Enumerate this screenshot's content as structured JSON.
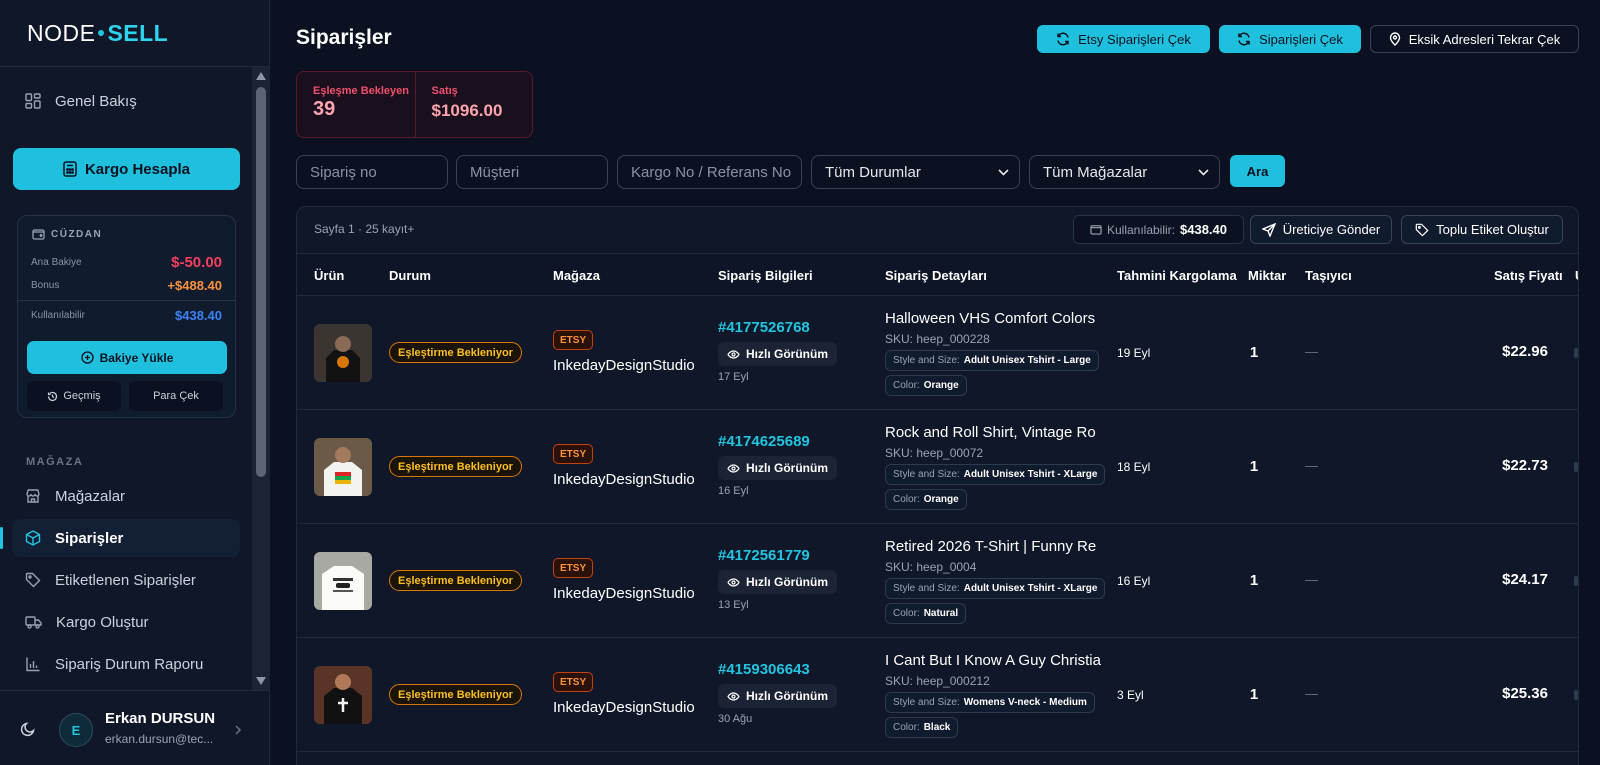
{
  "logo": {
    "part1": "NODE",
    "part2": "SELL"
  },
  "sidebar": {
    "overview": "Genel Bakış",
    "cargo_button": "Kargo Hesapla",
    "wallet": {
      "title": "CÜZDAN",
      "main_balance_label": "Ana Bakiye",
      "main_balance_value": "$-50.00",
      "bonus_label": "Bonus",
      "bonus_value": "+$488.40",
      "available_label": "Kullanılabilir",
      "available_value": "$438.40",
      "topup_button": "Bakiye Yükle",
      "history_button": "Geçmiş",
      "withdraw_button": "Para Çek"
    },
    "section_store": "MAĞAZA",
    "items": [
      {
        "label": "Mağazalar"
      },
      {
        "label": "Siparişler"
      },
      {
        "label": "Etiketlenen Siparişler"
      },
      {
        "label": "Kargo Oluştur"
      },
      {
        "label": "Sipariş Durum Raporu"
      }
    ]
  },
  "user": {
    "initial": "E",
    "name": "Erkan DURSUN",
    "email": "erkan.dursun@tec..."
  },
  "header": {
    "title": "Siparişler",
    "btn_etsy": "Etsy Siparişleri Çek",
    "btn_orders": "Siparişleri Çek",
    "btn_address": "Eksik Adresleri Tekrar Çek"
  },
  "stats": {
    "pending_label": "Eşleşme Bekleyen",
    "pending_value": "39",
    "sales_label": "Satış",
    "sales_value": "$1096.00"
  },
  "filters": {
    "order_no_placeholder": "Sipariş no",
    "customer_placeholder": "Müşteri",
    "cargo_placeholder": "Kargo No / Referans No",
    "status_select": "Tüm Durumlar",
    "store_select": "Tüm Mağazalar",
    "search_button": "Ara"
  },
  "table": {
    "paging": "Sayfa 1 · 25 kayıt+",
    "available_label": "Kullanılabilir:",
    "available_value": "$438.40",
    "send_producer": "Üreticiye Gönder",
    "bulk_label": "Toplu Etiket Oluştur",
    "headers": {
      "product": "Ürün",
      "status": "Durum",
      "store": "Mağaza",
      "order_info": "Sipariş Bilgileri",
      "order_details": "Sipariş Detayları",
      "est_shipping": "Tahmini Kargolama",
      "qty": "Miktar",
      "carrier": "Taşıyıcı",
      "price": "Satış Fiyatı",
      "extra": "U"
    },
    "rows": [
      {
        "status": "Eşleştirme Bekleniyor",
        "channel": "ETSY",
        "shop": "InkedayDesignStudio",
        "order_no": "#4177526768",
        "quick": "Hızlı Görünüm",
        "date": "17 Eyl",
        "title": "Halloween VHS Comfort Colors",
        "sku": "SKU: heep_000228",
        "opt1_label": "Style and Size:",
        "opt1_value": "Adult Unisex Tshirt - Large",
        "opt2_label": "Color:",
        "opt2_value": "Orange",
        "ship": "19 Eyl",
        "qty": "1",
        "carrier": "—",
        "price": "$22.96"
      },
      {
        "status": "Eşleştirme Bekleniyor",
        "channel": "ETSY",
        "shop": "InkedayDesignStudio",
        "order_no": "#4174625689",
        "quick": "Hızlı Görünüm",
        "date": "16 Eyl",
        "title": "Rock and Roll Shirt, Vintage Ro",
        "sku": "SKU: heep_00072",
        "opt1_label": "Style and Size:",
        "opt1_value": "Adult Unisex Tshirt - XLarge",
        "opt2_label": "Color:",
        "opt2_value": "Orange",
        "ship": "18 Eyl",
        "qty": "1",
        "carrier": "—",
        "price": "$22.73"
      },
      {
        "status": "Eşleştirme Bekleniyor",
        "channel": "ETSY",
        "shop": "InkedayDesignStudio",
        "order_no": "#4172561779",
        "quick": "Hızlı Görünüm",
        "date": "13 Eyl",
        "title": "Retired 2026 T-Shirt | Funny Re",
        "sku": "SKU: heep_0004",
        "opt1_label": "Style and Size:",
        "opt1_value": "Adult Unisex Tshirt - XLarge",
        "opt2_label": "Color:",
        "opt2_value": "Natural",
        "ship": "16 Eyl",
        "qty": "1",
        "carrier": "—",
        "price": "$24.17"
      },
      {
        "status": "Eşleştirme Bekleniyor",
        "channel": "ETSY",
        "shop": "InkedayDesignStudio",
        "order_no": "#4159306643",
        "quick": "Hızlı Görünüm",
        "date": "30 Ağu",
        "title": "I Cant But I Know A Guy Christia",
        "sku": "SKU: heep_000212",
        "opt1_label": "Style and Size:",
        "opt1_value": "Womens V-neck - Medium",
        "opt2_label": "Color:",
        "opt2_value": "Black",
        "ship": "3 Eyl",
        "qty": "1",
        "carrier": "—",
        "price": "$25.36"
      }
    ]
  },
  "colors": {
    "accent": "#1fc0de",
    "danger": "#f0506e",
    "warning": "#fbbf24"
  }
}
